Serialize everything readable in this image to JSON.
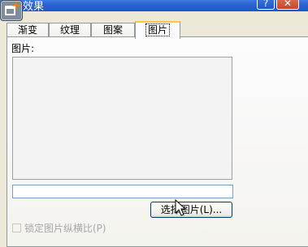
{
  "window": {
    "title": "效果",
    "help_label": "?",
    "close_label": "✕"
  },
  "tabs": [
    {
      "label": "渐变"
    },
    {
      "label": "纹理"
    },
    {
      "label": "图案"
    },
    {
      "label": "图片"
    }
  ],
  "picture": {
    "section_label": "图片:",
    "select_button_label": "选择图片(L)...",
    "lock_label": "锁定图片纵横比(P)",
    "lock_checked": false,
    "path_value": ""
  },
  "colors": {
    "titlebar": "#2a63d4",
    "dialog_bg": "#ece9d8",
    "active_tab_accent": "#ffc83c"
  }
}
